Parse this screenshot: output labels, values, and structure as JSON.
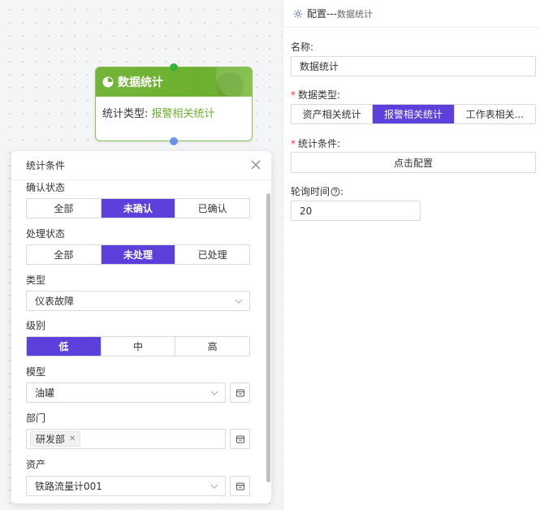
{
  "node": {
    "title": "数据统计",
    "stat_type_label": "统计类型:",
    "stat_type_value": "报警相关统计"
  },
  "panel": {
    "title": "统计条件",
    "confirm_status": {
      "label": "确认状态",
      "options": [
        "全部",
        "未确认",
        "已确认"
      ],
      "selected": "未确认"
    },
    "process_status": {
      "label": "处理状态",
      "options": [
        "全部",
        "未处理",
        "已处理"
      ],
      "selected": "未处理"
    },
    "type": {
      "label": "类型",
      "value": "仪表故障"
    },
    "level": {
      "label": "级别",
      "options": [
        "低",
        "中",
        "高"
      ],
      "selected": "低"
    },
    "model": {
      "label": "模型",
      "value": "油罐"
    },
    "department": {
      "label": "部门",
      "tags": [
        "研发部"
      ]
    },
    "asset": {
      "label": "资产",
      "value": "铁路流量计001"
    }
  },
  "config": {
    "title": "配置---",
    "subtitle": "数据统计",
    "name_label": "名称:",
    "name_value": "数据统计",
    "data_type_label": "数据类型:",
    "data_type_options": [
      "资产相关统计",
      "报警相关统计",
      "工作表相关..."
    ],
    "data_type_selected": "报警相关统计",
    "condition_label": "统计条件:",
    "condition_button": "点击配置",
    "poll_label": "轮询时间",
    "poll_value": "20"
  },
  "colors": {
    "primary": "#5d3fdc",
    "node_green": "#6cb02f",
    "required": "#e53935"
  }
}
